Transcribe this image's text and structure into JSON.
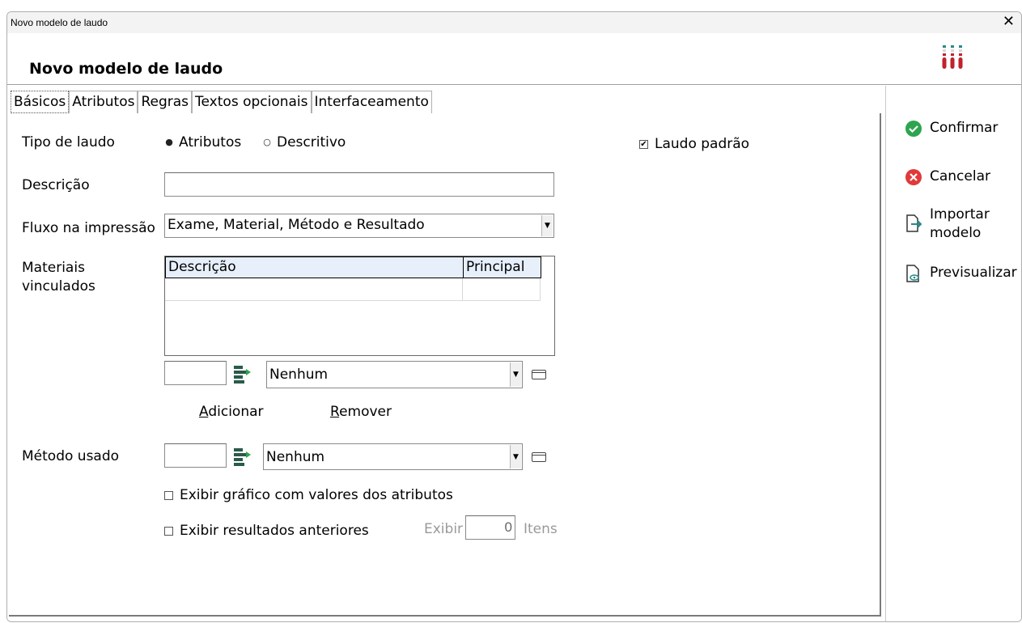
{
  "window": {
    "title": "Novo modelo de laudo",
    "close_glyph": "✕"
  },
  "header": {
    "title": "Novo modelo de laudo"
  },
  "tabs": [
    {
      "label": "Básicos"
    },
    {
      "label": "Atributos"
    },
    {
      "label": "Regras"
    },
    {
      "label": "Textos opcionais"
    },
    {
      "label": "Interfaceamento"
    }
  ],
  "form": {
    "tipo_label": "Tipo de laudo",
    "tipo_options": [
      {
        "label": "Atributos",
        "selected": true
      },
      {
        "label": "Descritivo",
        "selected": false
      }
    ],
    "laudo_padrao": {
      "label": "Laudo padrão",
      "checked": true
    },
    "descricao_label": "Descrição",
    "descricao_value": "",
    "fluxo_label": "Fluxo na impressão",
    "fluxo_value": "Exame, Material, Método e Resultado",
    "materiais_label_1": "Materiais",
    "materiais_label_2": "vinculados",
    "materiais_columns": [
      "Descrição",
      "Principal"
    ],
    "material_code": "",
    "material_select": "Nenhum",
    "adicionar_label": "Adicionar",
    "adicionar_access": "A",
    "remover_label": "Remover",
    "remover_access": "R",
    "metodo_label": "Método usado",
    "metodo_code": "",
    "metodo_select": "Nenhum",
    "grafico": {
      "label": "Exibir gráfico com valores dos atributos",
      "checked": false
    },
    "anteriores": {
      "label": "Exibir resultados anteriores",
      "checked": false
    },
    "exibir_label": "Exibir",
    "exibir_value": "0",
    "itens_label": "Itens"
  },
  "sidebar": {
    "confirmar": "Confirmar",
    "cancelar": "Cancelar",
    "importar_1": "Importar",
    "importar_2": "modelo",
    "previsualizar": "Previsualizar"
  },
  "colors": {
    "confirm_green": "#2ea44f",
    "cancel_red": "#e03a3a",
    "logo_red": "#c0222d",
    "logo_teal": "#2a8a8a",
    "grid_header": "#e6effa"
  },
  "icons": [
    "close-icon",
    "lab-tubes-logo-icon",
    "stack-arrow-icon",
    "window-icon",
    "check-circle-icon",
    "x-circle-icon",
    "import-file-icon",
    "preview-file-icon",
    "dropdown-arrow-icon"
  ]
}
